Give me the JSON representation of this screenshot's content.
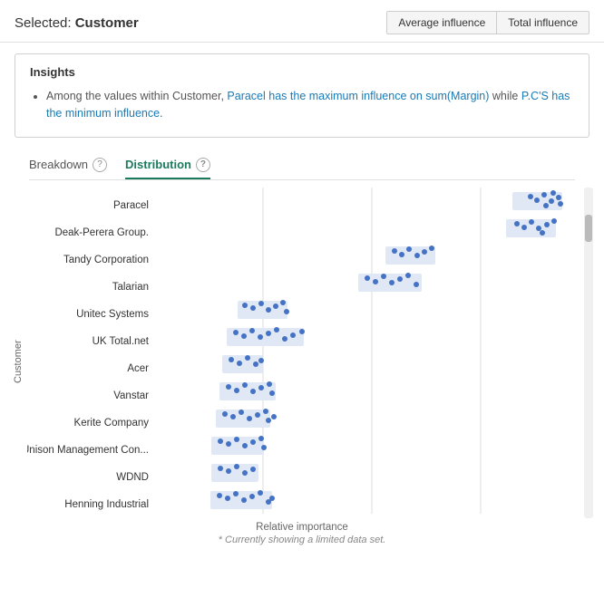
{
  "header": {
    "title_prefix": "Selected: ",
    "title_value": "Customer",
    "btn_average": "Average influence",
    "btn_total": "Total influence"
  },
  "insights": {
    "section_title": "Insights",
    "text_plain1": "Among the values within Customer, ",
    "highlight1": "Paracel has the maximum influence on sum(Margin)",
    "text_plain2": " while ",
    "highlight2": "P.C'S has the minimum influence.",
    "text_plain3": ""
  },
  "tabs": [
    {
      "id": "breakdown",
      "label": "Breakdown",
      "active": false
    },
    {
      "id": "distribution",
      "label": "Distribution",
      "active": true
    }
  ],
  "chart": {
    "y_axis_label": "Customer",
    "x_axis_label": "Relative importance",
    "footnote": "* Currently showing a limited data set.",
    "rows": [
      {
        "label": "Paracel"
      },
      {
        "label": "Deak-Perera Group."
      },
      {
        "label": "Tandy Corporation"
      },
      {
        "label": "Talarian"
      },
      {
        "label": "Unitec Systems"
      },
      {
        "label": "UK Total.net"
      },
      {
        "label": "Acer"
      },
      {
        "label": "Vanstar"
      },
      {
        "label": "Kerite Company"
      },
      {
        "label": "Unison Management Con..."
      },
      {
        "label": "WDND"
      },
      {
        "label": "Henning Industrial"
      }
    ]
  }
}
